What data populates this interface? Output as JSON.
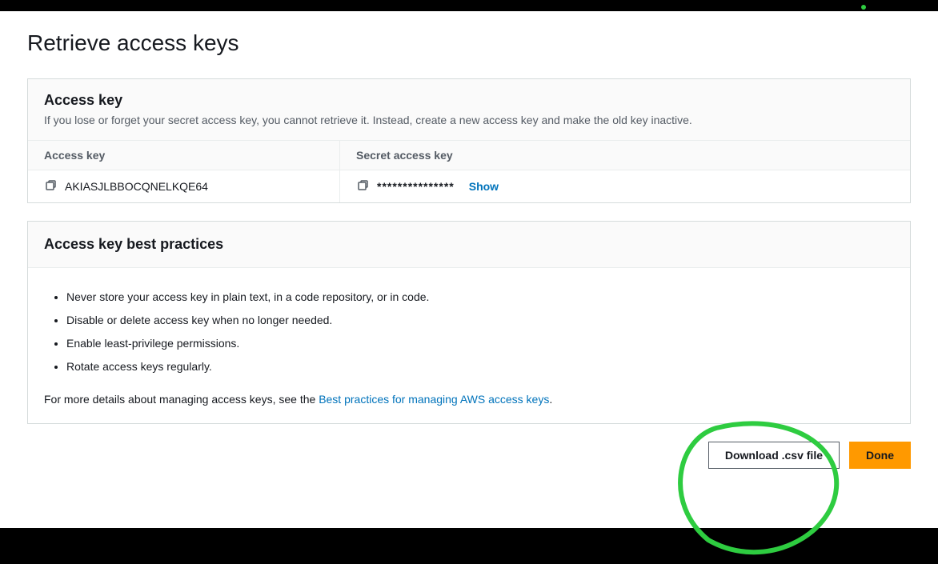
{
  "page": {
    "title": "Retrieve access keys"
  },
  "accessKeyPanel": {
    "title": "Access key",
    "description": "If you lose or forget your secret access key, you cannot retrieve it. Instead, create a new access key and make the old key inactive.",
    "columns": {
      "accessKey": "Access key",
      "secretKey": "Secret access key"
    },
    "row": {
      "accessKeyValue": "AKIASJLBBOCQNELKQE64",
      "secretMasked": "***************",
      "showLabel": "Show"
    }
  },
  "bestPractices": {
    "title": "Access key best practices",
    "items": [
      "Never store your access key in plain text, in a code repository, or in code.",
      "Disable or delete access key when no longer needed.",
      "Enable least-privilege permissions.",
      "Rotate access keys regularly."
    ],
    "moreDetailsPrefix": "For more details about managing access keys, see the ",
    "moreDetailsLink": "Best practices for managing AWS access keys",
    "moreDetailsSuffix": "."
  },
  "actions": {
    "download": "Download .csv file",
    "done": "Done"
  }
}
